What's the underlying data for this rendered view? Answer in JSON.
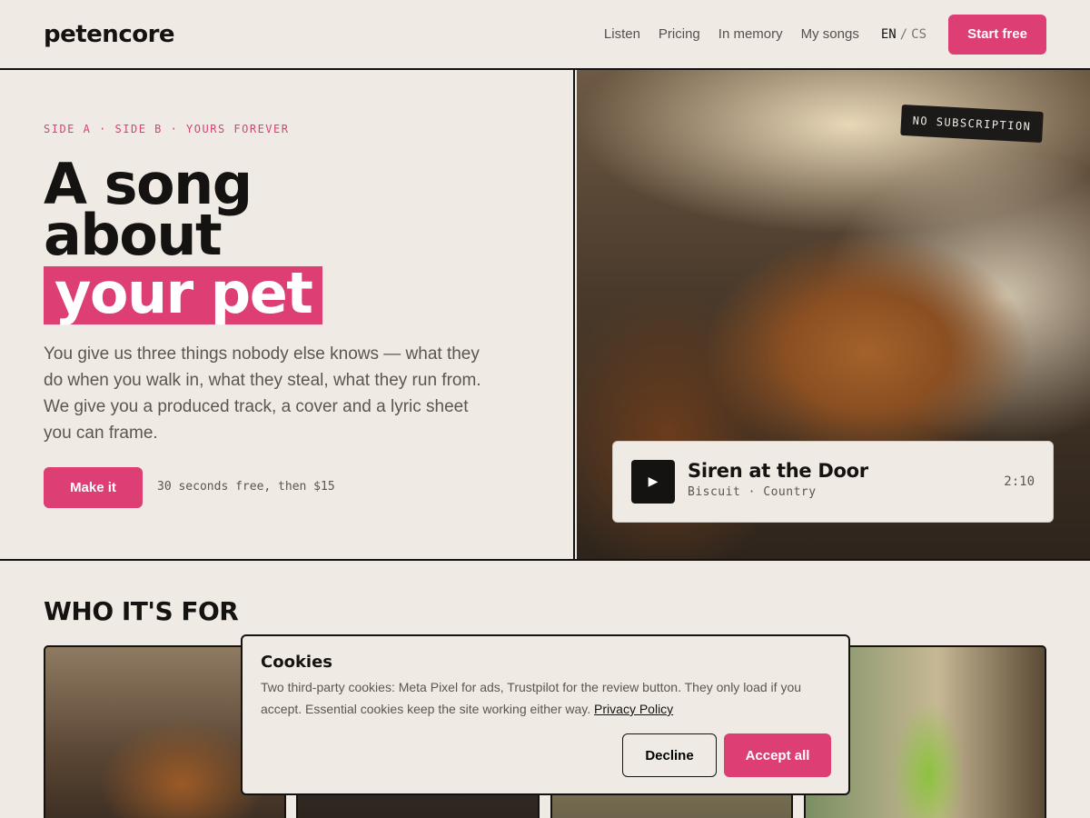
{
  "header": {
    "logo": "petencore",
    "nav": [
      "Listen",
      "Pricing",
      "In memory",
      "My songs"
    ],
    "lang_active": "EN",
    "lang_sep": "/",
    "lang_other": "CS",
    "cta": "Start free"
  },
  "hero": {
    "eyebrow": "SIDE A · SIDE B · YOURS FOREVER",
    "title_line1": "A song",
    "title_line2": "about",
    "title_highlight": "your pet",
    "lede": "You give us three things nobody else knows — what they do when you walk in, what they steal, what they run from. We give you a produced track, a cover and a lyric sheet you can frame.",
    "cta": "Make it",
    "hint": "30 seconds free, then $15"
  },
  "feature": {
    "badge": "NO SUBSCRIPTION",
    "track_title": "Siren at the Door",
    "track_meta": "Biscuit · Country",
    "track_time": "2:10"
  },
  "section": {
    "title": "WHO IT'S FOR"
  },
  "cookies": {
    "title": "Cookies",
    "text": "Two third-party cookies: Meta Pixel for ads, Trustpilot for the review button. They only load if you accept. Essential cookies keep the site working either way.",
    "link": "Privacy Policy",
    "decline": "Decline",
    "accept": "Accept all"
  },
  "colors": {
    "accent": "#dd3e74",
    "background": "#efebe4",
    "ink": "#151311"
  }
}
